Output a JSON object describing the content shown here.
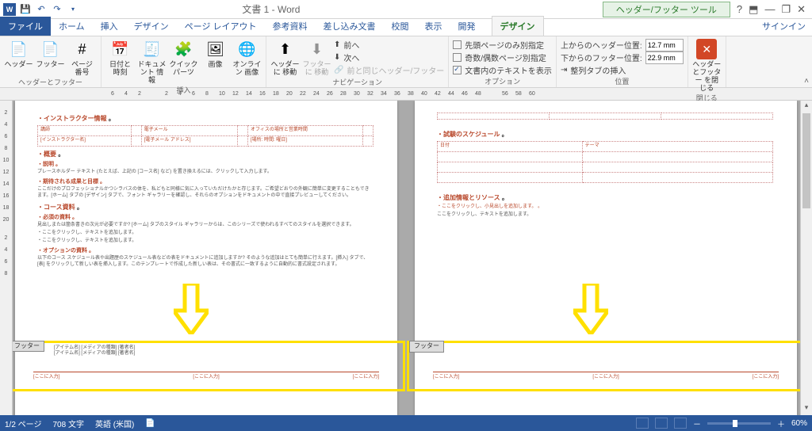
{
  "title": "文書 1 - Word",
  "contextual_tab_title": "ヘッダー/フッター ツール",
  "signin": "サインイン",
  "tabs": {
    "file": "ファイル",
    "home": "ホーム",
    "insert": "挿入",
    "design": "デザイン",
    "layout": "ページ レイアウト",
    "references": "参考資料",
    "mailings": "差し込み文書",
    "review": "校閲",
    "view": "表示",
    "developer": "開発",
    "hf_design": "デザイン"
  },
  "ribbon": {
    "groups": {
      "hf": "ヘッダーとフッター",
      "insert": "挿入",
      "nav": "ナビゲーション",
      "options": "オプション",
      "position": "位置",
      "close": "閉じる"
    },
    "buttons": {
      "header": "ヘッダー",
      "footer": "フッター",
      "pagenum": "ページ\n番号",
      "datetime": "日付と\n時刻",
      "docinfo": "ドキュメント\n情報",
      "quickparts": "クイック パーツ",
      "picture": "画像",
      "online_pic": "オンライン\n画像",
      "goto_header": "ヘッダーに\n移動",
      "goto_footer": "フッターに\n移動",
      "prev": "前へ",
      "next": "次へ",
      "link_prev": "前と同じヘッダー/フッター",
      "close": "ヘッダーとフッター\nを閉じる",
      "align_tab": "整列タブの挿入"
    },
    "options": {
      "first_diff": "先頭ページのみ別指定",
      "odd_even": "奇数/偶数ページ別指定",
      "show_text": "文書内のテキストを表示"
    },
    "position": {
      "from_top_label": "上からのヘッダー位置:",
      "from_top_val": "12.7 mm",
      "from_bottom_label": "下からのフッター位置:",
      "from_bottom_val": "22.9 mm"
    }
  },
  "ruler_h": [
    "6",
    "4",
    "2",
    "",
    "2",
    "4",
    "6",
    "8",
    "10",
    "12",
    "14",
    "16",
    "18",
    "20",
    "22",
    "24",
    "26",
    "28",
    "30",
    "32",
    "34",
    "36",
    "38",
    "40",
    "42",
    "44",
    "46",
    "48",
    "",
    "56",
    "58",
    "60"
  ],
  "ruler_v": [
    "",
    "2",
    "4",
    "6",
    "8",
    "10",
    "12",
    "14",
    "16",
    "18",
    "20",
    "",
    "2",
    "4",
    "6",
    "8"
  ],
  "doc": {
    "p1": {
      "h1": "インストラクター情報",
      "tbl1": [
        [
          "講師",
          "",
          "電子メール",
          "",
          "オフィスの場所と営業時間",
          ""
        ],
        [
          "[インストラクター名]",
          "",
          "[電子メール アドレス]",
          "",
          "[場所: 時間: 曜日]",
          ""
        ]
      ],
      "h2": "概要",
      "h2a": "説明",
      "body1": "プレースホルダー テキスト (たとえば、上記の [コース名] など) を置き換えるには、クリックして入力します。",
      "h2b": "期待される成果と目標",
      "body2": "ここだけのプロフェッショナルかつシラバスの体を、私どもと同様に気に入っていただけたかと存じます。ご希望どおりの外観に簡単に変更することもできます。[ホーム] タブの [デザイン] タブで、フォント ギャラリーを確認し、それらのオプションをドキュメントの中で直接プレビューしてください。",
      "h3": "コース資料",
      "h3a": "必須の資料",
      "body3": "見出しまたは箇条書きの次元が必要ですか? [ホーム] タブのスタイル ギャラリーからは、このシリーズで使われるすべてのスタイルを選択できます。",
      "bullets": [
        "ここをクリックし、テキストを追加します。",
        "ここをクリックし、テキストを追加します。"
      ],
      "h3b": "オプションの資料",
      "body4": "以下のコース スケジュール表や出題歴のスケジュール表などの表をドキュメントに追加しますか? そのような追加はとても簡単に行えます。[挿入] タブで、[表] をクリックして新しい表を挿入します。このテンプレートで作成した新しい表は、その書式に一致するように自動的に書式設定されます。",
      "footer_tag": "フッター",
      "foot_items": [
        [
          "[アイテム名]",
          "[メディアの種類]",
          "[著者名]"
        ],
        [
          "[アイテム名]",
          "[メディアの種類]",
          "[著者名]"
        ]
      ],
      "foot_entry": "[ここに入力]"
    },
    "p2": {
      "h1": "試験のスケジュール",
      "tbl2": [
        [
          "日付",
          "テーマ"
        ]
      ],
      "h2": "追加情報とリソース",
      "body1": "ここをクリックし、小見出しを追加します。",
      "body2": "ここをクリックし、テキストを追加します。",
      "footer_tag": "フッター",
      "foot_entry": "[ここに入力]"
    }
  },
  "status": {
    "page": "1/2 ページ",
    "words": "708 文字",
    "lang": "英語 (米国)",
    "zoom": "60%"
  }
}
